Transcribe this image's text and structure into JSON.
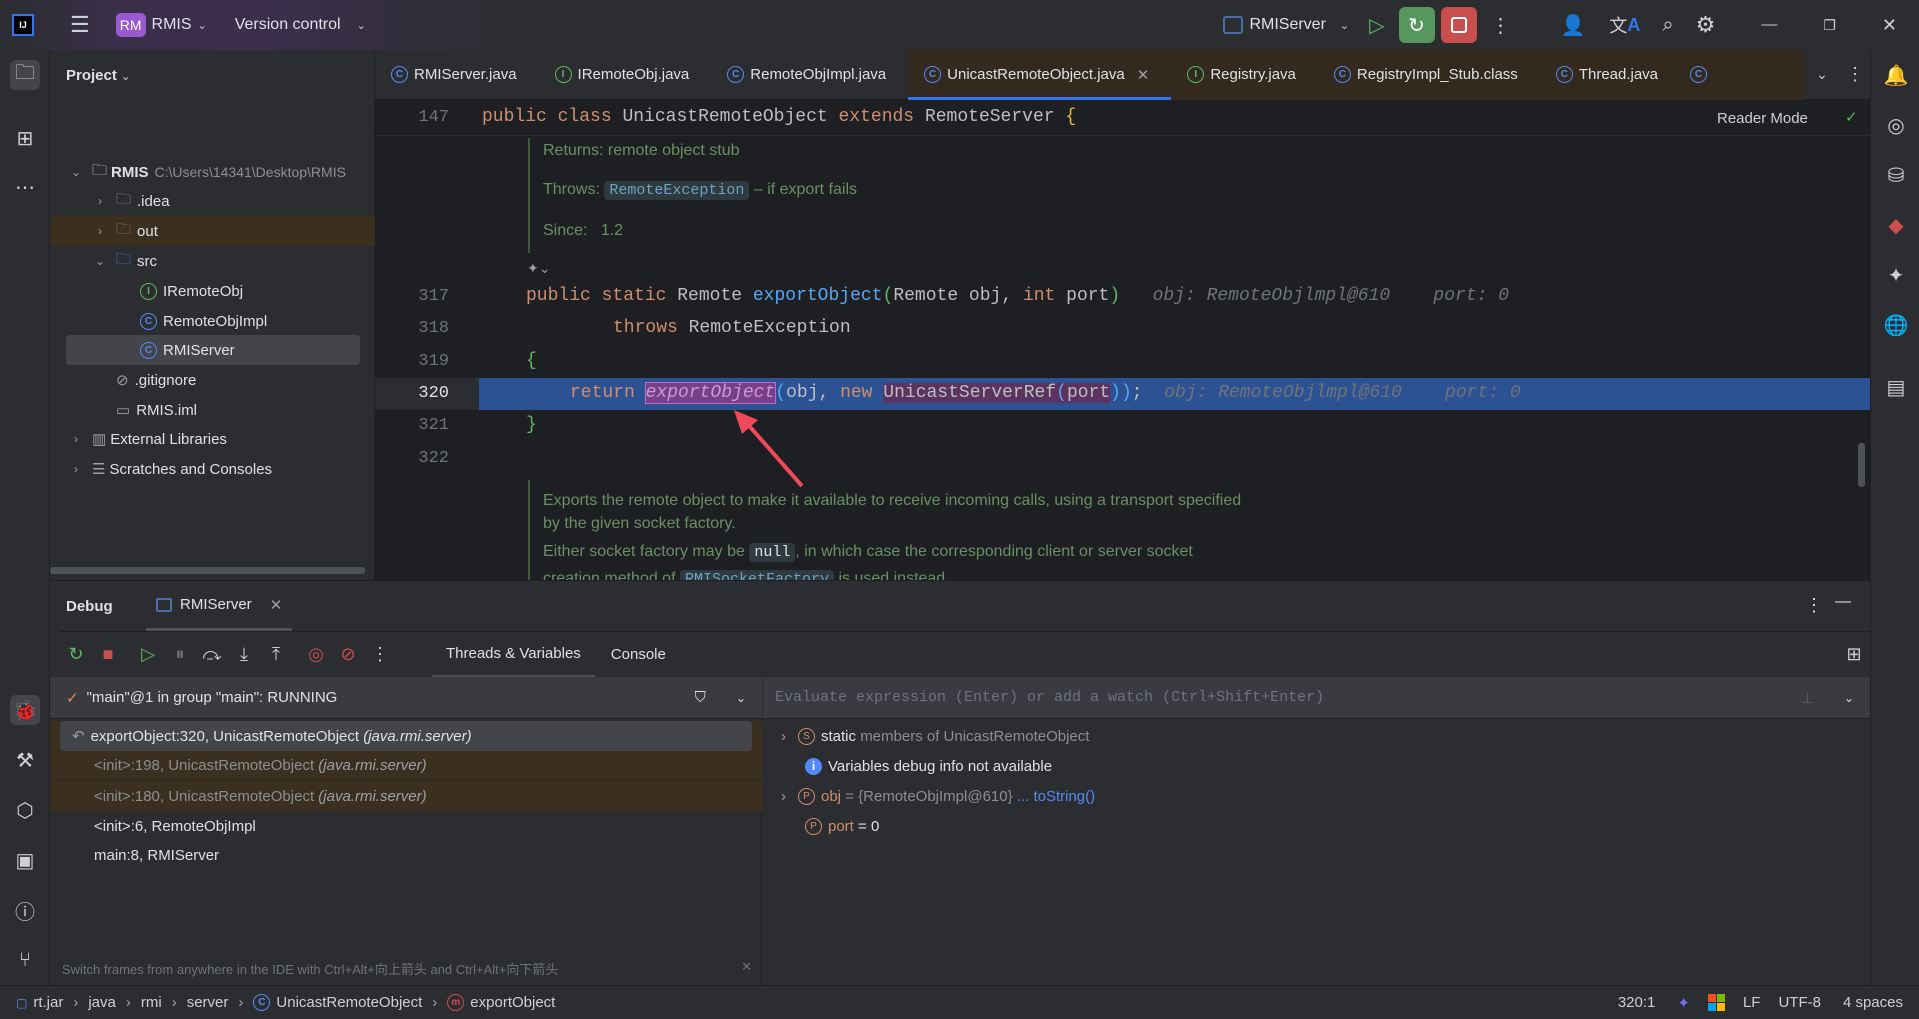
{
  "titlebar": {
    "app_badge": "RM",
    "project": "RMIS",
    "vcs": "Version control",
    "run_config": "RMIServer"
  },
  "project_panel": {
    "title": "Project",
    "root": {
      "name": "RMIS",
      "path": "C:\\Users\\14341\\Desktop\\RMIS"
    },
    "items": [
      {
        "label": ".idea"
      },
      {
        "label": "out"
      },
      {
        "label": "src"
      },
      {
        "label": "IRemoteObj"
      },
      {
        "label": "RemoteObjImpl"
      },
      {
        "label": "RMIServer"
      },
      {
        "label": ".gitignore"
      },
      {
        "label": "RMIS.iml"
      },
      {
        "label": "External Libraries"
      },
      {
        "label": "Scratches and Consoles"
      }
    ]
  },
  "tabs": [
    {
      "label": "RMIServer.java"
    },
    {
      "label": "IRemoteObj.java"
    },
    {
      "label": "RemoteObjImpl.java"
    },
    {
      "label": "UnicastRemoteObject.java",
      "active": true
    },
    {
      "label": "Registry.java"
    },
    {
      "label": "RegistryImpl_Stub.class"
    },
    {
      "label": "Thread.java"
    }
  ],
  "editor": {
    "reader_mode": "Reader Mode",
    "line_numbers": [
      "147",
      "317",
      "318",
      "319",
      "320",
      "321",
      "322"
    ],
    "class_decl": {
      "public": "public",
      "class": "class",
      "name": "UnicastRemoteObject",
      "extends": "extends",
      "super": "RemoteServer",
      "brace": "{"
    },
    "doc_top": {
      "returns_label": "Returns:",
      "returns": "remote object stub",
      "throws_label": "Throws:",
      "throws_type": "RemoteException",
      "throws_text": "– if export fails",
      "since_label": "Since:",
      "since": "1.2"
    },
    "l317": {
      "mods": "public static",
      "type": "Remote",
      "method": "exportObject",
      "params_a": "Remote obj, ",
      "int": "int",
      "params_b": " port",
      "hint": "obj: RemoteObjlmpl@610    port: 0"
    },
    "l318": {
      "throws": "throws",
      "type": "RemoteException"
    },
    "l319": "{",
    "l320": {
      "return": "return",
      "call": "exportObject",
      "args_a": "obj, ",
      "new": "new",
      "ctor": "UnicastServerRef",
      "args_b": "port",
      "end": ";",
      "hint": "obj: RemoteObjlmpl@610    port: 0"
    },
    "l321": "}",
    "doc_bottom": {
      "line1": "Exports the remote object to make it available to receive incoming calls, using a transport specified",
      "line2": "by the given socket factory.",
      "line3a": "Either socket factory may be",
      "null": "null",
      "line3b": ", in which case the corresponding client or server socket",
      "line4a": "creation method of",
      "factory": "RMISocketFactory",
      "line4b": "is used instead."
    }
  },
  "debug": {
    "title": "Debug",
    "session": "RMIServer",
    "tabs": [
      "Threads & Variables",
      "Console"
    ],
    "thread": "\"main\"@1 in group \"main\": RUNNING",
    "frames": [
      {
        "text": "exportObject:320, UnicastRemoteObject",
        "pkg": "(java.rmi.server)"
      },
      {
        "text": "<init>:198, UnicastRemoteObject",
        "pkg": "(java.rmi.server)"
      },
      {
        "text": "<init>:180, UnicastRemoteObject",
        "pkg": "(java.rmi.server)"
      },
      {
        "text": "<init>:6, RemoteObjImpl",
        "pkg": ""
      },
      {
        "text": "main:8, RMIServer",
        "pkg": ""
      }
    ],
    "hint": "Switch frames from anywhere in the IDE with Ctrl+Alt+向上箭头 and Ctrl+Alt+向下箭头",
    "eval_placeholder": "Evaluate expression (Enter) or add a watch (Ctrl+Shift+Enter)",
    "variables": [
      {
        "name": "static",
        "value": "members of UnicastRemoteObject"
      },
      {
        "name": "Variables debug info not available",
        "value": ""
      },
      {
        "name": "obj",
        "value": "= {RemoteObjImpl@610}",
        "link": "... toString()"
      },
      {
        "name": "port",
        "value": "= 0"
      }
    ]
  },
  "statusbar": {
    "breadcrumbs": [
      "rt.jar",
      "java",
      "rmi",
      "server",
      "UnicastRemoteObject",
      "exportObject"
    ],
    "position": "320:1",
    "line_sep": "LF",
    "encoding": "UTF-8",
    "indent": "4 spaces"
  },
  "colors": {
    "accent": "#3574f0",
    "exec_line": "#2d5293",
    "keyword": "#cf8e6d",
    "method": "#56a8f5"
  }
}
